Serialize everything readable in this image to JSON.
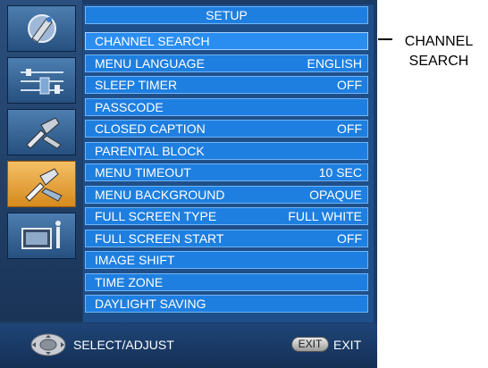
{
  "menu": {
    "title": "SETUP",
    "items": [
      {
        "label": "CHANNEL SEARCH",
        "value": ""
      },
      {
        "label": "MENU LANGUAGE",
        "value": "ENGLISH"
      },
      {
        "label": "SLEEP TIMER",
        "value": "OFF"
      },
      {
        "label": "PASSCODE",
        "value": ""
      },
      {
        "label": "CLOSED CAPTION",
        "value": "OFF"
      },
      {
        "label": "PARENTAL BLOCK",
        "value": ""
      },
      {
        "label": "MENU TIMEOUT",
        "value": "10 SEC"
      },
      {
        "label": "MENU BACKGROUND",
        "value": "OPAQUE"
      },
      {
        "label": "FULL SCREEN TYPE",
        "value": "FULL WHITE"
      },
      {
        "label": "FULL SCREEN START",
        "value": "OFF"
      },
      {
        "label": "IMAGE SHIFT",
        "value": ""
      },
      {
        "label": "TIME ZONE",
        "value": ""
      },
      {
        "label": "DAYLIGHT SAVING",
        "value": ""
      }
    ]
  },
  "sidebar": {
    "icons": [
      "picture-icon",
      "audio-icon",
      "tools-icon",
      "setup-icon",
      "input-icon"
    ],
    "active": "setup-icon"
  },
  "footer": {
    "select_label": "SELECT/ADJUST",
    "exit_button": "EXIT",
    "exit_label": "EXIT"
  },
  "callout": {
    "text": "CHANNEL\nSEARCH"
  },
  "colors": {
    "row": "#1e7fe0",
    "active_icon": "#f0a83a",
    "background": "#1b3c67"
  }
}
